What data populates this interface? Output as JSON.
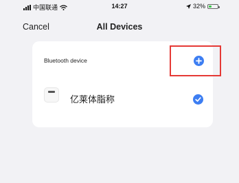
{
  "status_bar": {
    "carrier": "中国联通",
    "time": "14:27",
    "battery_text": "32%",
    "battery_level": 0.32
  },
  "nav": {
    "cancel_label": "Cancel",
    "title": "All Devices"
  },
  "section": {
    "header": "Bluetooth device"
  },
  "device": {
    "name": "亿莱体脂称",
    "selected": true
  },
  "colors": {
    "accent": "#3d7ef2",
    "highlight": "#e53935",
    "battery": "#3cc84a",
    "background": "#f2f2f5"
  }
}
